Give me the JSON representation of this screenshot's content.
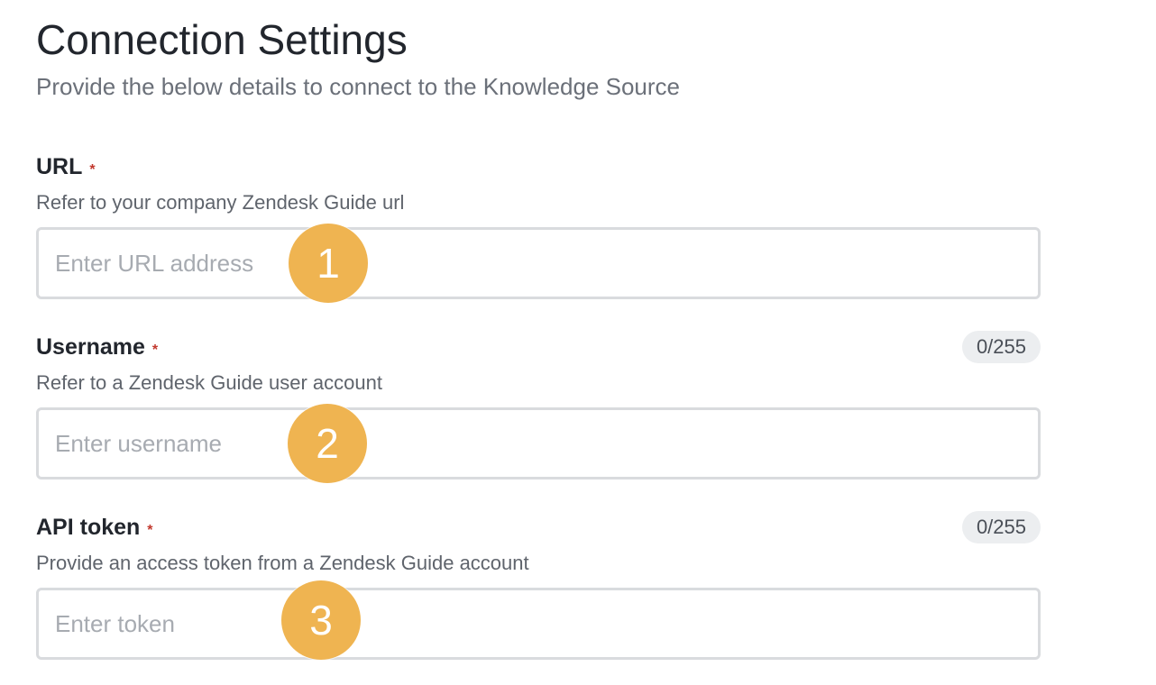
{
  "header": {
    "title": "Connection Settings",
    "subtitle": "Provide the below details to connect to the Knowledge Source"
  },
  "fields": {
    "url": {
      "label": "URL",
      "required_mark": "*",
      "help": "Refer to your company Zendesk Guide url",
      "placeholder": "Enter URL address",
      "value": "",
      "step": "1"
    },
    "username": {
      "label": "Username",
      "required_mark": "*",
      "counter": "0/255",
      "help": "Refer to a Zendesk Guide user account",
      "placeholder": "Enter username",
      "value": "",
      "step": "2"
    },
    "api_token": {
      "label": "API token",
      "required_mark": "*",
      "counter": "0/255",
      "help": "Provide an access token from a Zendesk Guide account",
      "placeholder": "Enter token",
      "value": "",
      "step": "3"
    }
  },
  "colors": {
    "required": "#c2382d",
    "step_badge": "#efb451",
    "input_border": "#d9dbde",
    "counter_bg": "#eceef0"
  }
}
